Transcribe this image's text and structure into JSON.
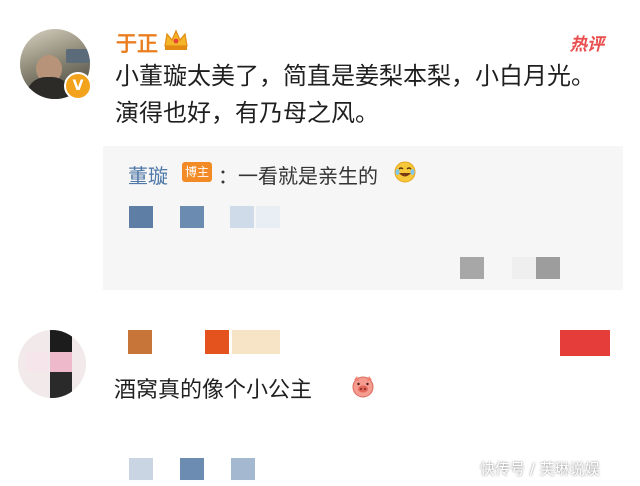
{
  "comment1": {
    "username": "于正",
    "hot_tag": "热评",
    "verified_glyph": "V",
    "text": "小董璇太美了，简直是姜梨本梨，小白月光。演得也好，有乃母之风。",
    "reply": {
      "author": "董璇",
      "badge": "博主",
      "text": "：一看就是亲生的"
    }
  },
  "comment2": {
    "text": "酒窝真的像个小公主"
  },
  "watermark": "快传号 / 芙琳说娱",
  "icons": [
    "crown-icon",
    "verified-badge-icon",
    "laugh-cry-emoji-icon",
    "pig-emoji-icon"
  ],
  "colors": {
    "username": "#ea7f21",
    "hot_tag": "#e94d4d",
    "reply_author": "#4e78a8",
    "blogger_badge": "#f28b25"
  }
}
